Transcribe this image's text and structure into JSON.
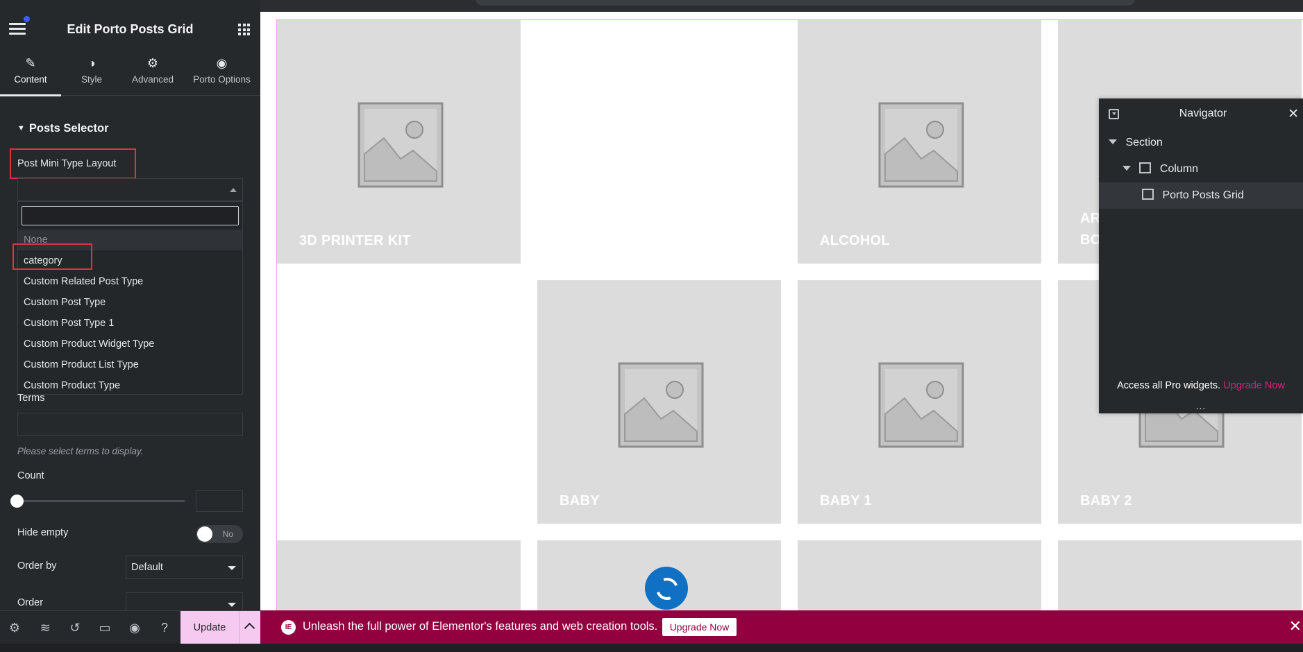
{
  "panel": {
    "title": "Edit Porto Posts Grid",
    "tabs": [
      {
        "label": "Content",
        "icon": "pencil-icon"
      },
      {
        "label": "Style",
        "icon": "contrast-icon"
      },
      {
        "label": "Advanced",
        "icon": "gear-icon"
      },
      {
        "label": "Porto Options",
        "icon": "circle-dot-icon"
      }
    ],
    "section_title": "Posts Selector",
    "post_mini_type_layout_label": "Post Mini Type Layout",
    "dropdown": {
      "search_value": "",
      "options": [
        "None",
        "category",
        "Custom Related Post Type",
        "Custom Post Type",
        "Custom Post Type 1",
        "Custom Product Widget Type",
        "Custom Product List Type",
        "Custom Product Type"
      ]
    },
    "terms_label": "Terms",
    "terms_help": "Please select terms to display.",
    "count_label": "Count",
    "count_value": "",
    "hide_empty_label": "Hide empty",
    "hide_empty_value": "No",
    "order_by_label": "Order by",
    "order_by_value": "Default",
    "order_label": "Order",
    "order_value": ""
  },
  "footer": {
    "icons": [
      "settings-icon",
      "layers-icon",
      "history-icon",
      "responsive-icon",
      "preview-icon",
      "help-icon"
    ],
    "update_label": "Update"
  },
  "canvas": {
    "tiles": [
      {
        "label": "3D PRINTER KIT"
      },
      {
        "label": "ALCOHOL"
      },
      {
        "label": "AR BO"
      },
      {
        "label": "BABY"
      },
      {
        "label": "BABY 1"
      },
      {
        "label": "BABY 2"
      }
    ]
  },
  "navigator": {
    "title": "Navigator",
    "items": [
      {
        "label": "Section"
      },
      {
        "label": "Column"
      },
      {
        "label": "Porto Posts Grid"
      }
    ],
    "promo_text": "Access all Pro widgets.",
    "promo_link": "Upgrade Now",
    "dots": "..."
  },
  "promo_bar": {
    "text": "Unleash the full power of Elementor's features and web creation tools.",
    "button": "Upgrade Now",
    "close": "✕"
  },
  "colors": {
    "accent_pink": "#f5c9f0",
    "promo_bg": "#93003f",
    "highlight_red": "#d93540",
    "loader_blue": "#1070c4"
  }
}
